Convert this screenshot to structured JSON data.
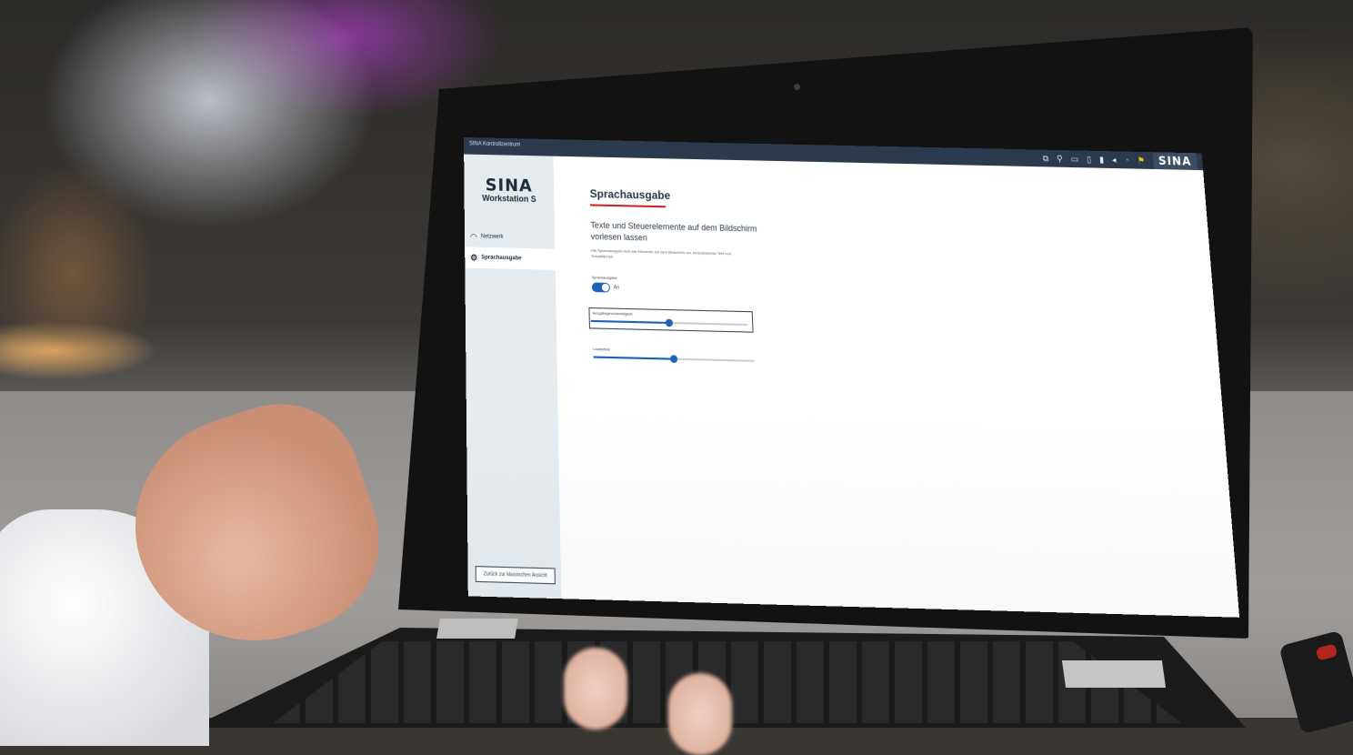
{
  "window": {
    "title": "SINA Kontrollzentrum"
  },
  "tray": {
    "icons": [
      "monitor-icon",
      "usb-icon",
      "screen-icon",
      "clipboard-icon",
      "battery-icon",
      "volume-icon",
      "wifi-icon",
      "flag-icon"
    ],
    "brand": "SINA"
  },
  "sidebar": {
    "logo_mark": "SINA",
    "logo_sub": "Workstation S",
    "items": [
      {
        "label": "Netzwerk",
        "icon": "wifi-icon"
      },
      {
        "label": "Sprachausgabe",
        "icon": "gear-icon",
        "selected": true
      }
    ],
    "back_button": "Zurück zur klassischen Ansicht"
  },
  "main": {
    "title": "Sprachausgabe",
    "heading": "Texte und Steuerelemente auf dem Bildschirm vorlesen lassen",
    "description": "Die Sprachausgabe liest alle Elemente auf dem Bildschirm vor, beispielsweise Text und Schaltflächen.",
    "toggle_label": "Sprachausgabe",
    "toggle_state": "An",
    "toggle_on": true,
    "speed_label": "Ausgabegeschwindigkeit",
    "speed_value": 0.5,
    "volume_label": "Lautstärke",
    "volume_value": 0.5
  },
  "colors": {
    "accent_blue": "#1d63b8",
    "title_rule_red": "#d2222d",
    "topbar": "#2b3a4d",
    "sidebar": "#e5ebee",
    "wifi_green": "#38c46a"
  }
}
